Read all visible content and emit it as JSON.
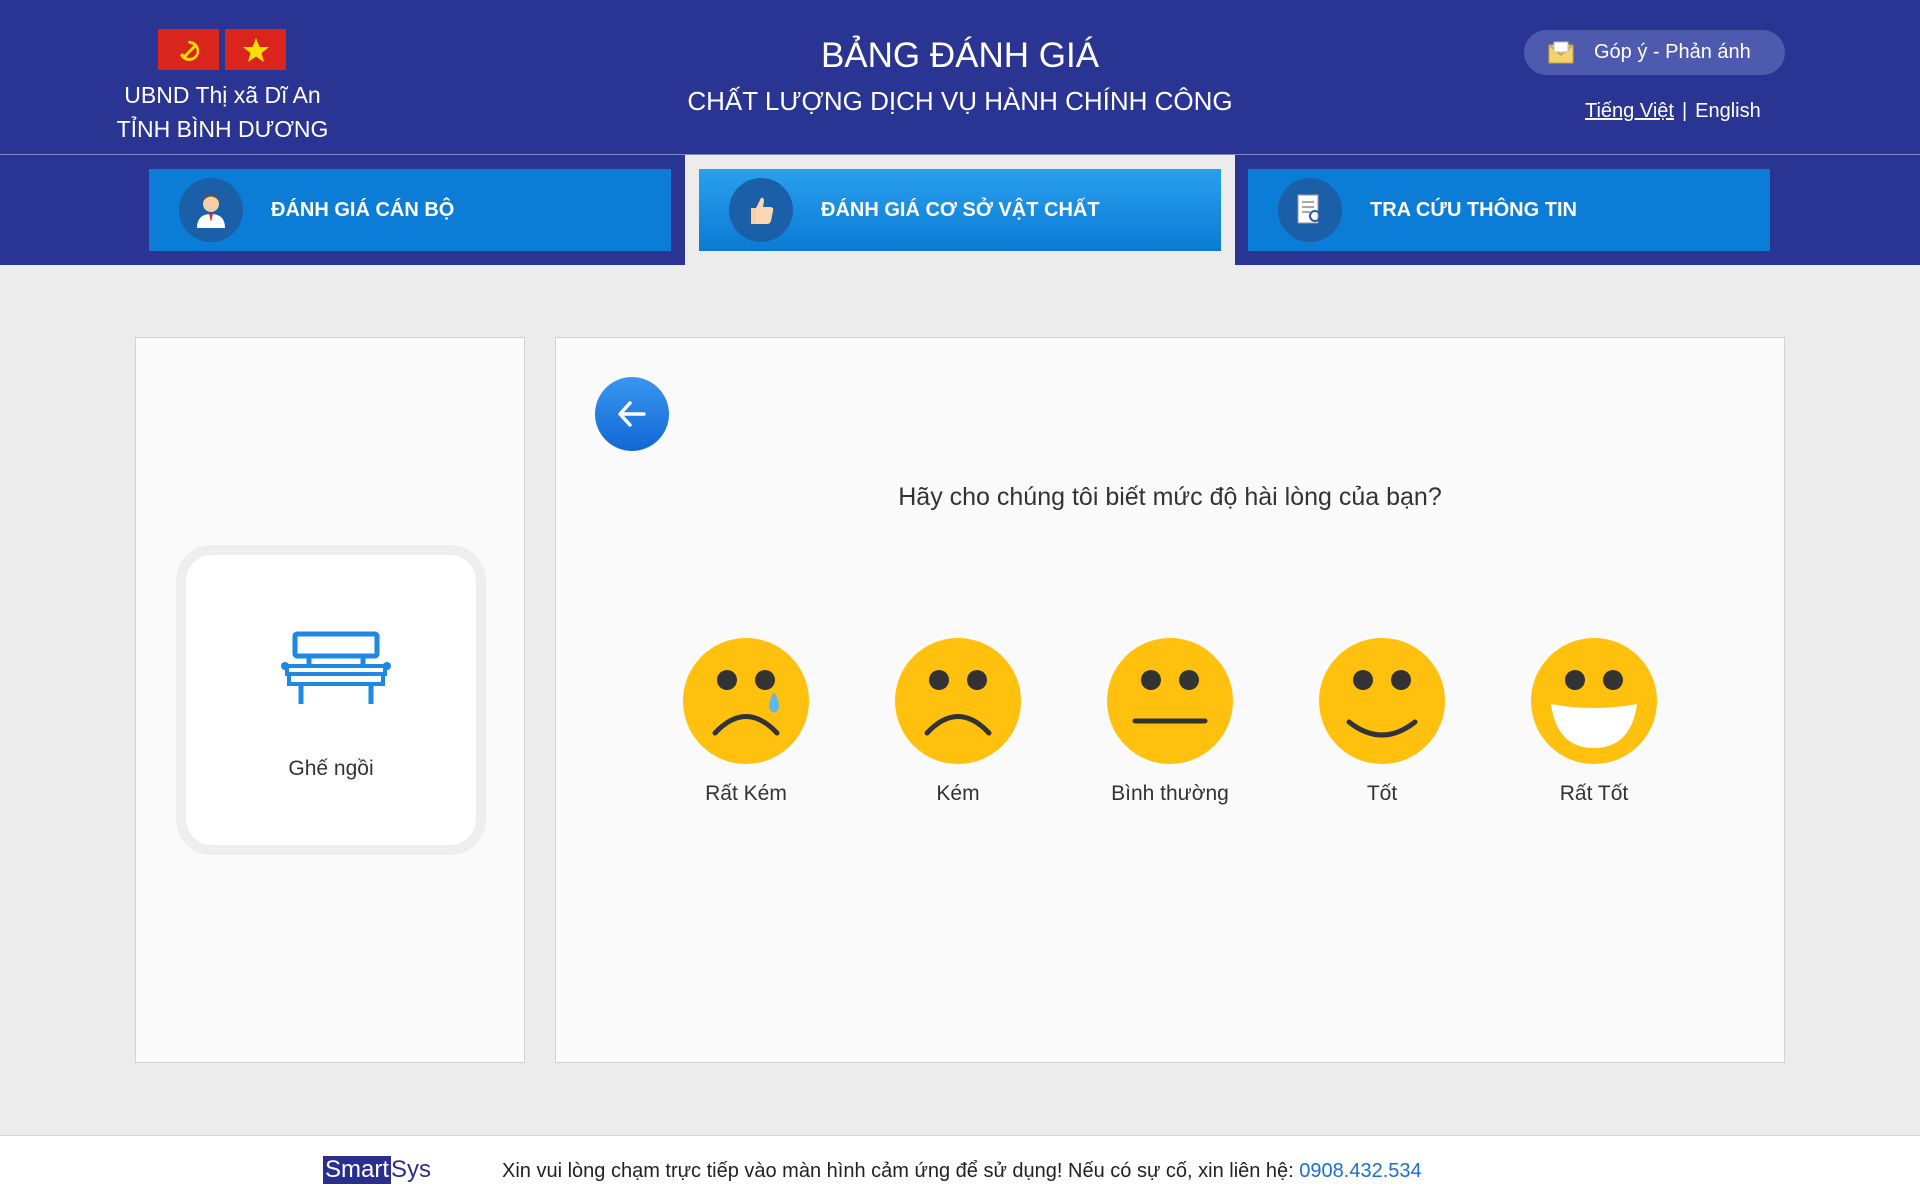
{
  "header": {
    "org_line1": "UBND Thị xã Dĩ An",
    "org_line2": "TỈNH BÌNH DƯƠNG",
    "title": "BẢNG ĐÁNH GIÁ",
    "subtitle": "CHẤT LƯỢNG DỊCH VỤ HÀNH CHÍNH CÔNG",
    "feedback_label": "Góp ý - Phản ánh",
    "lang_vi": "Tiếng Việt",
    "lang_sep": "|",
    "lang_en": "English",
    "flag_colors": {
      "red": "#da251d",
      "star": "#ffde00"
    }
  },
  "tabs": [
    {
      "label": "ĐÁNH GIÁ CÁN BỘ",
      "icon": "staff-icon",
      "active": false
    },
    {
      "label": "ĐÁNH GIÁ CƠ SỞ VẬT CHẤT",
      "icon": "thumbs-up-icon",
      "active": true
    },
    {
      "label": "TRA CỨU THÔNG TIN",
      "icon": "document-search-icon",
      "active": false
    }
  ],
  "item": {
    "label": "Ghế ngồi",
    "icon": "bench-icon"
  },
  "question": "Hãy cho chúng tôi biết mức độ hài lòng của bạn?",
  "ratings": [
    {
      "label": "Rất Kém",
      "icon": "crying-face-icon"
    },
    {
      "label": "Kém",
      "icon": "sad-face-icon"
    },
    {
      "label": "Bình thường",
      "icon": "neutral-face-icon"
    },
    {
      "label": "Tốt",
      "icon": "smile-face-icon"
    },
    {
      "label": "Rất Tốt",
      "icon": "big-smile-face-icon"
    }
  ],
  "footer": {
    "logo_smart": "Smart",
    "logo_sys": "Sys",
    "message": "Xin vui lòng chạm trực tiếp vào màn hình cảm ứng để sử dụng! Nếu có sự cố, xin liên hệ: ",
    "phone": "0908.432.534"
  },
  "colors": {
    "header_bg": "#2a3593",
    "tab_bg": "#0b7dd6",
    "accent": "#1a6fd6",
    "emoji": "#ffc10e"
  }
}
